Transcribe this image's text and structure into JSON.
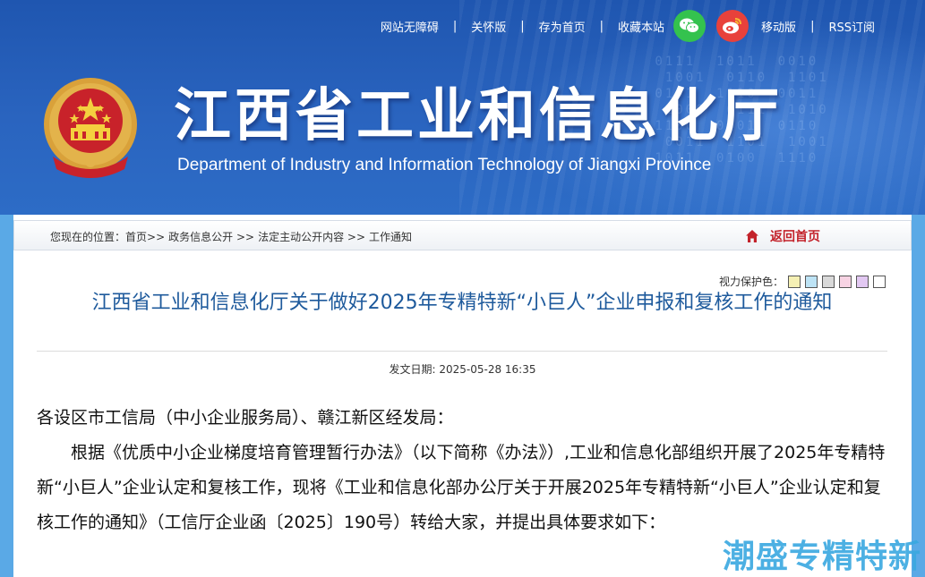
{
  "header": {
    "top_links": [
      "网站无障碍",
      "关怀版",
      "存为首页",
      "收藏本站"
    ],
    "mobile_label": "移动版",
    "rss_label": "RSS订阅",
    "site_title": "江西省工业和信息化厅",
    "site_subtitle": "Department of Industry and Information Technology of Jiangxi Province",
    "icons": {
      "wechat": "wechat-icon",
      "weibo": "weibo-icon",
      "emblem": "national-emblem-icon"
    },
    "colors": {
      "banner": "#1f56b0",
      "wechat": "#34c24e",
      "weibo": "#e8413b"
    }
  },
  "breadcrumb": {
    "prefix": "您现在的位置：",
    "items": [
      "首页>>",
      "政务信息公开 >>",
      "法定主动公开内容 >>",
      "工作通知"
    ],
    "home_label": "返回首页"
  },
  "vision": {
    "label": "视力保护色：",
    "swatches": [
      "#f5f0b4",
      "#bde3f5",
      "#d9d9d9",
      "#f7d3e3",
      "#e2c8f2",
      "#ffffff"
    ]
  },
  "article": {
    "title": "江西省工业和信息化厅关于做好2025年专精特新“小巨人”企业申报和复核工作的通知",
    "date_label": "发文日期: 2025-05-28 16:35",
    "salutation": "各设区市工信局（中小企业服务局）、赣江新区经发局：",
    "paragraph1": "根据《优质中小企业梯度培育管理暂行办法》（以下简称《办法》）,工业和信息化部组织开展了2025年专精特新“小巨人”企业认定和复核工作，现将《工业和信息化部办公厅关于开展2025年专精特新“小巨人”企业认定和复核工作的通知》（工信厅企业函〔2025〕190号）转给大家，并提出具体要求如下："
  },
  "watermark": "潮盛专精特新"
}
